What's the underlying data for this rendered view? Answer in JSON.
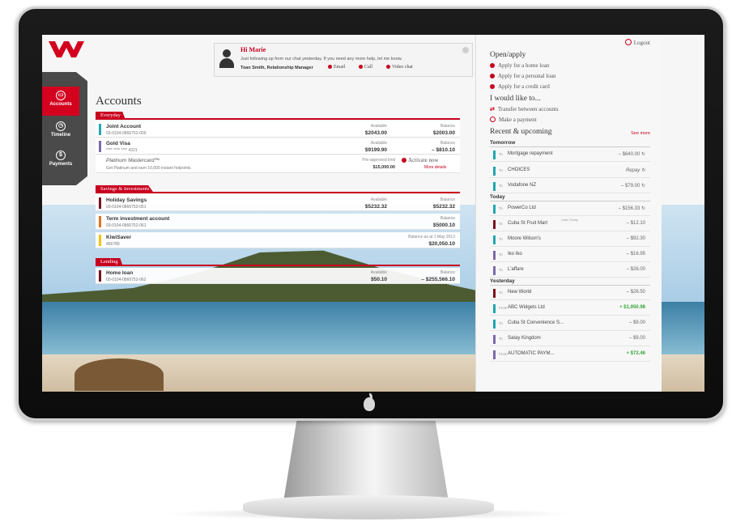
{
  "chat": {
    "greeting": "Hi Marie",
    "message": "Just following up from our chat yesterday. If you need any more help, let me know.",
    "manager": "Toan Smith, Relationship Manager",
    "email": "Email",
    "call": "Call",
    "video": "Video chat"
  },
  "nav": {
    "accounts": "Accounts",
    "timeline": "Timeline",
    "payments": "Payments"
  },
  "accounts": {
    "title": "Accounts",
    "everyday": {
      "label": "Everyday",
      "rows": [
        {
          "name": "Joint Account",
          "number": "03-0104-0866752-000",
          "available_label": "Available",
          "available": "$2043.00",
          "balance_label": "Balance",
          "balance": "$2003.00"
        },
        {
          "name": "Gold Visa",
          "number": "**** **** **** 4321",
          "available_label": "Available",
          "available": "$9199.90",
          "balance_label": "Balance",
          "balance": "– $810.10"
        }
      ],
      "promo": {
        "name": "Platinum Mastercard™",
        "desc": "Get Platinum and earn 10,000 instant hotpoints",
        "limit_label": "Pre-approved limit",
        "limit": "$15,000.00",
        "activate": "Activate now",
        "more": "More details"
      }
    },
    "savings": {
      "label": "Savings & Investments",
      "rows": [
        {
          "name": "Holiday Savings",
          "number": "03-0104-0866752-051",
          "available_label": "Available",
          "available": "$5232.32",
          "balance_label": "Balance",
          "balance": "$5232.32"
        },
        {
          "name": "Term investment account",
          "number": "03-0104-0866752-061",
          "balance_label": "Balance",
          "balance": "$5000.10"
        },
        {
          "name": "KiwiSaver",
          "number": "456789",
          "balance_label": "Balance as at 1 May 2013",
          "balance": "$20,050.10"
        }
      ]
    },
    "lending": {
      "label": "Lending",
      "rows": [
        {
          "name": "Home loan",
          "number": "03-0104-0866752-062",
          "available_label": "Available",
          "available": "$50.10",
          "balance_label": "Balance",
          "balance": "– $255,566.10"
        }
      ]
    }
  },
  "right": {
    "logout": "Logout",
    "open_apply": "Open/apply",
    "apply_links": [
      "Apply for a home loan",
      "Apply for a personal loan",
      "Apply for a credit card"
    ],
    "would_like": "I would like to...",
    "transfer": "Transfer between accounts",
    "make_payment": "Make a payment",
    "recent": "Recent & upcoming",
    "see_more": "See more",
    "tomorrow": "Tomorrow",
    "today": "Today",
    "yesterday": "Yesterday",
    "later_today": "Later Today",
    "tx_tomorrow": [
      {
        "pre": "To",
        "name": "Mortgage repayment",
        "amount": "– $640.00 ↻"
      },
      {
        "pre": "To",
        "name": "CHOICES",
        "amount": "Repay ↻"
      },
      {
        "pre": "To",
        "name": "Vodafone NZ",
        "amount": "– $79.00 ↻"
      }
    ],
    "tx_today": [
      {
        "pre": "To",
        "name": "PowerCo Ltd",
        "amount": "– $156.33 ↻"
      },
      {
        "pre": "To",
        "name": "Cuba St Fruit Mart",
        "amount": "– $12.10"
      },
      {
        "pre": "To",
        "name": "Moore Wilson's",
        "amount": "– $92.30"
      },
      {
        "pre": "To",
        "name": "Iko Iko",
        "amount": "– $16.95"
      },
      {
        "pre": "To",
        "name": "L'affare",
        "amount": "– $26.00"
      }
    ],
    "tx_yesterday": [
      {
        "pre": "To",
        "name": "New World",
        "amount": "– $26.50"
      },
      {
        "pre": "From",
        "name": "ABC Widgets Ltd",
        "amount": "+ $1,950.98"
      },
      {
        "pre": "To",
        "name": "Cuba St Convenience S...",
        "amount": "– $9.00"
      },
      {
        "pre": "To",
        "name": "Satay Kingdom",
        "amount": "– $9.00"
      },
      {
        "pre": "From",
        "name": "AUTOMATIC PAYM...",
        "amount": "+ $72.46"
      }
    ]
  },
  "colors": {
    "brand_red": "#c8001e",
    "teal": "#1fa7b0",
    "purple": "#7b6aa8",
    "orange": "#e8731c",
    "yellow": "#f2c200",
    "maroon": "#7a1020",
    "positive": "#3aa63a"
  }
}
